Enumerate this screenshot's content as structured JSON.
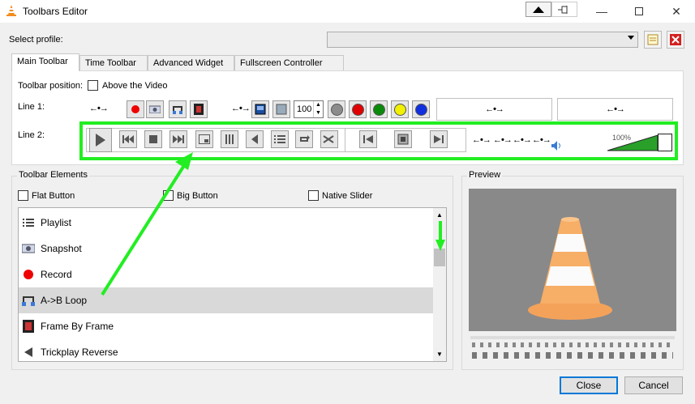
{
  "window": {
    "title": "Toolbars Editor",
    "controls": [
      "minimize-icon",
      "maximize-icon",
      "close-icon"
    ]
  },
  "profile": {
    "label": "Select profile:",
    "selected": ""
  },
  "tabs": [
    {
      "label": "Main Toolbar",
      "active": true
    },
    {
      "label": "Time Toolbar",
      "active": false
    },
    {
      "label": "Advanced Widget",
      "active": false
    },
    {
      "label": "Fullscreen Controller",
      "active": false
    }
  ],
  "toolbar_position": {
    "label": "Toolbar position:",
    "checkbox_label": "Above the Video",
    "checked": false
  },
  "line1": {
    "label": "Line 1:",
    "spin_value": "100",
    "colors": [
      "#8c8c8c",
      "#e00000",
      "#0a8a0a",
      "#f0f000",
      "#1030e0"
    ]
  },
  "line2": {
    "label": "Line 2:",
    "volume": "100%"
  },
  "toolbar_elements": {
    "title": "Toolbar Elements",
    "flat_button": "Flat Button",
    "big_button": "Big Button",
    "native_slider": "Native Slider",
    "items": [
      {
        "label": "Playlist",
        "icon": "playlist-icon"
      },
      {
        "label": "Snapshot",
        "icon": "snapshot-icon"
      },
      {
        "label": "Record",
        "icon": "record-icon"
      },
      {
        "label": "A->B Loop",
        "icon": "ab-loop-icon"
      },
      {
        "label": "Frame By Frame",
        "icon": "frame-by-frame-icon"
      },
      {
        "label": "Trickplay Reverse",
        "icon": "trickplay-reverse-icon"
      }
    ],
    "selected_index": 3
  },
  "preview": {
    "title": "Preview"
  },
  "buttons": {
    "close": "Close",
    "cancel": "Cancel"
  }
}
